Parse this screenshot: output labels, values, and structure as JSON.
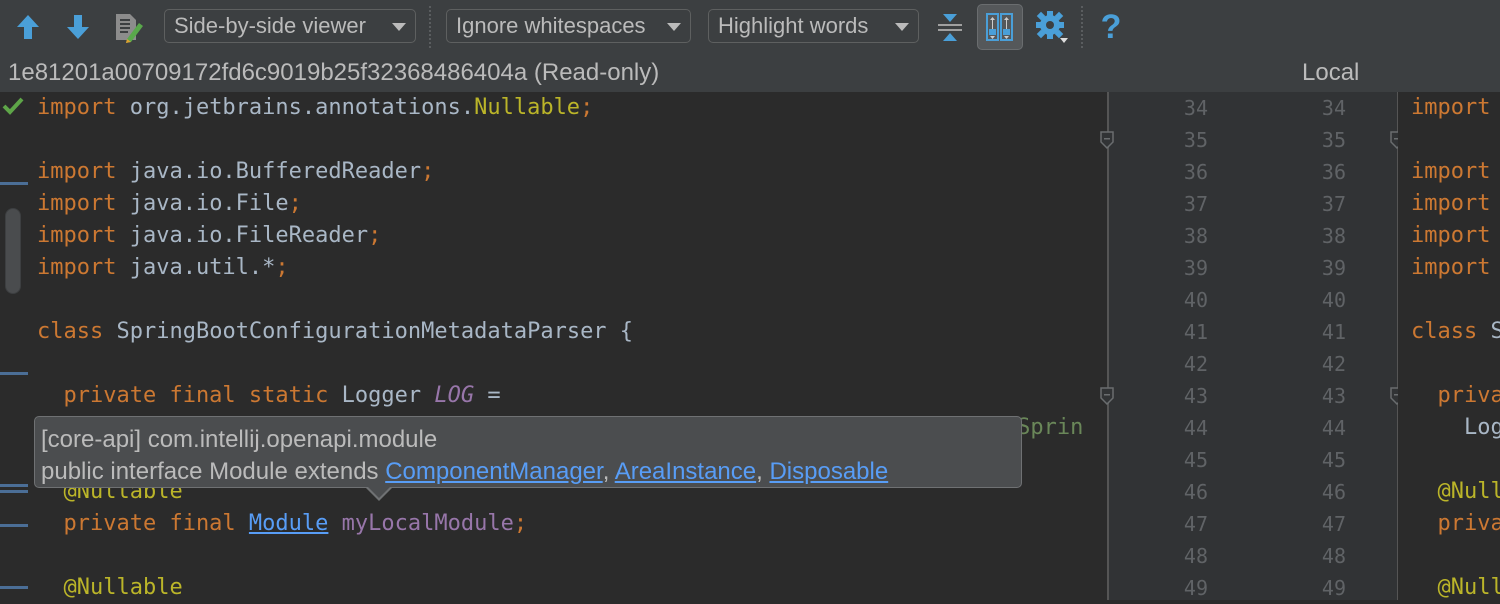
{
  "toolbar": {
    "prev_diff_icon": "arrow-up-icon",
    "next_diff_icon": "arrow-down-icon",
    "edit_source_icon": "edit-source-icon",
    "viewer_mode": "Side-by-side viewer",
    "whitespace_mode": "Ignore whitespaces",
    "highlight_mode": "Highlight words",
    "collapse_unchanged_icon": "collapse-unchanged-icon",
    "sync_scroll_icon": "synchronize-scrolling-icon",
    "sync_scroll_active": true,
    "settings_icon": "gear-icon",
    "help_label": "?"
  },
  "titles": {
    "left": "1e81201a00709172fd6c9019b25f32368486404a (Read-only)",
    "right": "Local"
  },
  "left_code": [
    [
      {
        "t": "import ",
        "c": "kw"
      },
      {
        "t": "org.jetbrains.annotations.",
        "c": "id"
      },
      {
        "t": "Nullable",
        "c": "ann"
      },
      {
        "t": ";",
        "c": "kw"
      }
    ],
    [],
    [
      {
        "t": "import ",
        "c": "kw"
      },
      {
        "t": "java.io.BufferedReader",
        "c": "id"
      },
      {
        "t": ";",
        "c": "kw"
      }
    ],
    [
      {
        "t": "import ",
        "c": "kw"
      },
      {
        "t": "java.io.File",
        "c": "id"
      },
      {
        "t": ";",
        "c": "kw"
      }
    ],
    [
      {
        "t": "import ",
        "c": "kw"
      },
      {
        "t": "java.io.FileReader",
        "c": "id"
      },
      {
        "t": ";",
        "c": "kw"
      }
    ],
    [
      {
        "t": "import ",
        "c": "kw"
      },
      {
        "t": "java.util.*",
        "c": "id"
      },
      {
        "t": ";",
        "c": "kw"
      }
    ],
    [],
    [
      {
        "t": "class ",
        "c": "kw"
      },
      {
        "t": "SpringBootConfigurationMetadataParser {",
        "c": "id"
      }
    ],
    [],
    [
      {
        "t": "  private final static ",
        "c": "kw"
      },
      {
        "t": "Logger ",
        "c": "id"
      },
      {
        "t": "LOG",
        "c": "fld-i"
      },
      {
        "t": " =",
        "c": "id"
      }
    ],
    [
      {
        "t": "                                                                         .Sprin",
        "c": "str"
      }
    ],
    [],
    [
      {
        "t": "  @Nullable",
        "c": "ann"
      }
    ],
    [
      {
        "t": "  private final ",
        "c": "kw"
      },
      {
        "t": "Module",
        "c": "link"
      },
      {
        "t": " ",
        "c": "id"
      },
      {
        "t": "myLocalModule",
        "c": "fld"
      },
      {
        "t": ";",
        "c": "kw"
      }
    ],
    [],
    [
      {
        "t": "  @Nullable",
        "c": "ann"
      }
    ]
  ],
  "right_code": [
    [
      {
        "t": "import",
        "c": "kw"
      }
    ],
    [],
    [
      {
        "t": "import",
        "c": "kw"
      }
    ],
    [
      {
        "t": "import",
        "c": "kw"
      }
    ],
    [
      {
        "t": "import",
        "c": "kw"
      }
    ],
    [
      {
        "t": "import",
        "c": "kw"
      }
    ],
    [],
    [
      {
        "t": "class ",
        "c": "kw"
      },
      {
        "t": "S",
        "c": "id"
      }
    ],
    [],
    [
      {
        "t": "  priva",
        "c": "kw"
      }
    ],
    [
      {
        "t": "    Log",
        "c": "id"
      }
    ],
    [],
    [
      {
        "t": "  @Null",
        "c": "ann"
      }
    ],
    [
      {
        "t": "  priva",
        "c": "kw"
      }
    ],
    [],
    [
      {
        "t": "  @Null",
        "c": "ann"
      }
    ]
  ],
  "line_numbers_left": [
    "34",
    "35",
    "36",
    "37",
    "38",
    "39",
    "40",
    "41",
    "42",
    "43",
    "44",
    "45",
    "46",
    "47",
    "48",
    "49"
  ],
  "line_numbers_right": [
    "34",
    "35",
    "36",
    "37",
    "38",
    "39",
    "40",
    "41",
    "42",
    "43",
    "44",
    "45",
    "46",
    "47",
    "48",
    "49"
  ],
  "tooltip": {
    "line1": "[core-api] com.intellij.openapi.module",
    "line2_prefix": "public interface Module extends ",
    "links": [
      "ComponentManager",
      "AreaInstance",
      "Disposable"
    ],
    "sep": ", "
  },
  "status": {
    "no_problems_icon": "checkmark-icon"
  }
}
